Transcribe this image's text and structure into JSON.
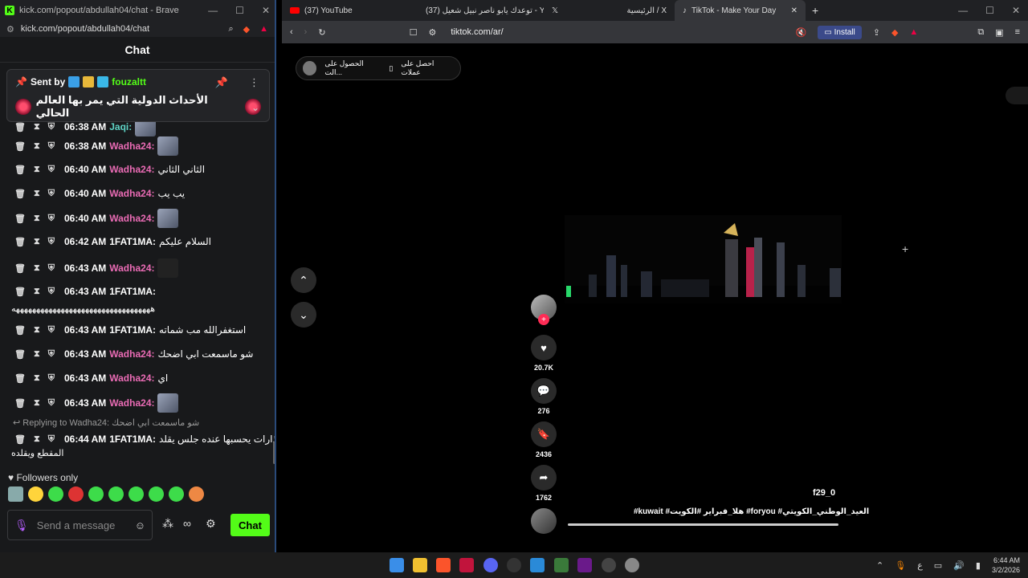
{
  "kick_window": {
    "title": "kick.com/popout/abdullah04/chat - Brave",
    "url": "kick.com/popout/abdullah04/chat",
    "chat_title": "Chat"
  },
  "pinned": {
    "sent_by_label": "Sent by",
    "username": "fouzaltt",
    "message": "الأحداث الدولية التي يمر بها العالم الحالي"
  },
  "messages": [
    {
      "time": "06:38 AM",
      "user": "Jaqi:",
      "text": ""
    },
    {
      "time": "06:38 AM",
      "user": "Wadha24:",
      "text": ""
    },
    {
      "time": "06:40 AM",
      "user": "Wadha24:",
      "text": "الثاني الثاني"
    },
    {
      "time": "06:40 AM",
      "user": "Wadha24:",
      "text": "يب يب"
    },
    {
      "time": "06:40 AM",
      "user": "Wadha24:",
      "text": ""
    },
    {
      "time": "06:42 AM",
      "user": "1FAT1MA:",
      "text": "السلام عليكم"
    },
    {
      "time": "06:43 AM",
      "user": "Wadha24:",
      "text": ""
    },
    {
      "time": "06:43 AM",
      "user": "1FAT1MA:",
      "text": ""
    },
    {
      "time": "06:43 AM",
      "user": "1FAT1MA:",
      "text": "استغفرالله مب شماته"
    },
    {
      "time": "06:43 AM",
      "user": "Wadha24:",
      "text": "شو ماسمعت ابي اضحك"
    },
    {
      "time": "06:43 AM",
      "user": "Wadha24:",
      "text": "اي"
    },
    {
      "time": "06:43 AM",
      "user": "Wadha24:",
      "text": ""
    },
    {
      "time": "06:44 AM",
      "user": "1FAT1MA:",
      "text": "انذارات يحسبها عنده جلس يقلد"
    }
  ],
  "long_haha": "ههههههههههههههههههههههههههههههههههه",
  "wrap_line": "المقطع ويقلده",
  "replying": "Replying to Wadha24: شو ماسمعت ابي اضحك",
  "followers_only": "Followers only",
  "input_placeholder": "Send a message",
  "chat_button": "Chat",
  "browser": {
    "tabs": [
      "(37) YouTube",
      "(37) توعدك يابو ناصر نبيل شعيل - YouTube",
      "الرئيسية / X",
      "TikTok - Make Your Day"
    ],
    "url": "tiktok.com/ar/",
    "install": "Install"
  },
  "tiktok": {
    "pill_items": [
      "احصل على عملات",
      "الحصول على الت..."
    ],
    "likes": "20.7K",
    "comments": "276",
    "saves": "2436",
    "shares": "1762",
    "author": "f29_0",
    "description": "#kuwait #هلا_فبراير #الكويت #foryou #العيد_الوطني_الكويتي"
  },
  "taskbar": {
    "lang": "ع",
    "time": "6:44 AM",
    "date": "3/2/2026"
  }
}
